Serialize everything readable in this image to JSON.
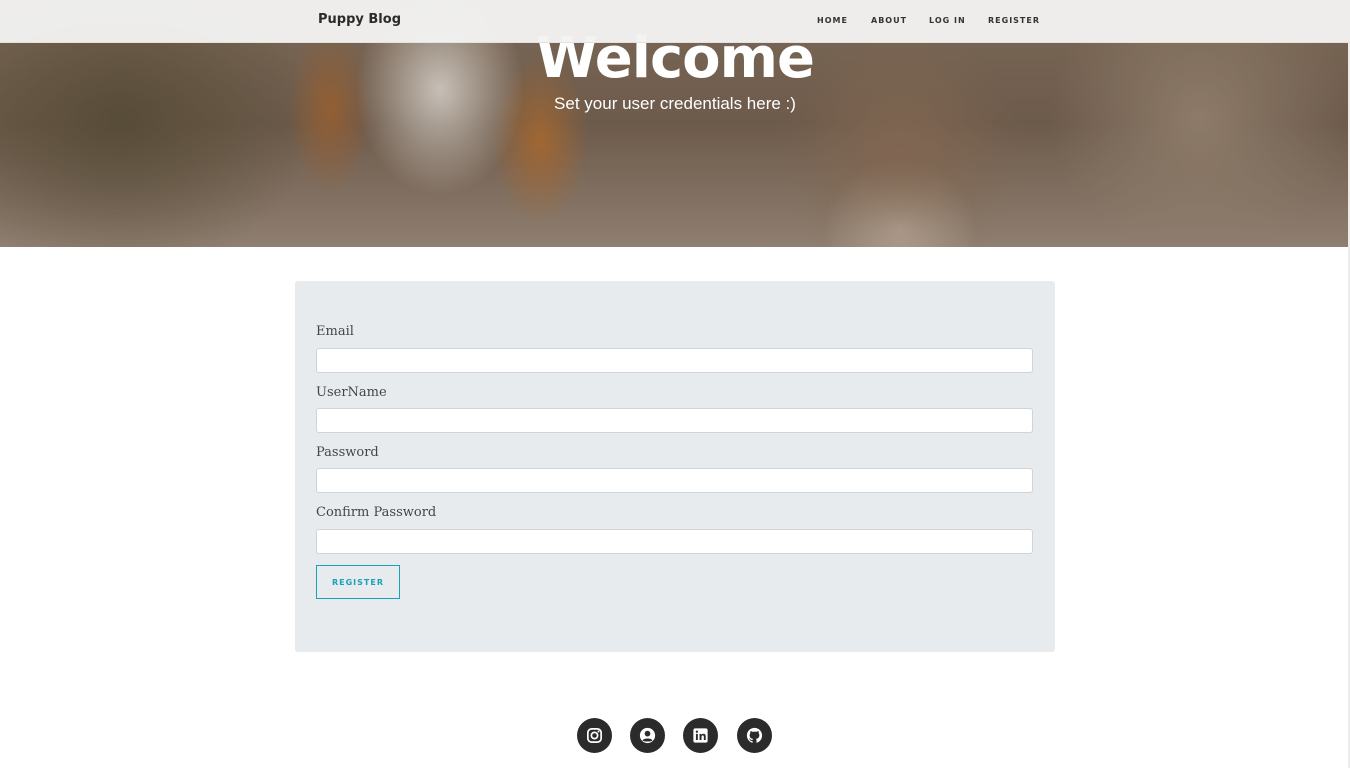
{
  "navbar": {
    "brand": "Puppy Blog",
    "links": [
      "HOME",
      "ABOUT",
      "LOG IN",
      "REGISTER"
    ]
  },
  "hero": {
    "title": "Welcome",
    "subtitle": "Set your user credentials here :)"
  },
  "form": {
    "fields": [
      {
        "label": "Email",
        "value": ""
      },
      {
        "label": "UserName",
        "value": ""
      },
      {
        "label": "Password",
        "value": ""
      },
      {
        "label": "Confirm Password",
        "value": ""
      }
    ],
    "submit_label": "REGISTER"
  },
  "footer": {
    "social_icons": [
      "instagram-icon",
      "user-circle-icon",
      "linkedin-icon",
      "github-icon"
    ]
  },
  "colors": {
    "accent": "#17a2b8",
    "card_background": "#e8ebee",
    "icon_background": "#2b2b2b"
  }
}
